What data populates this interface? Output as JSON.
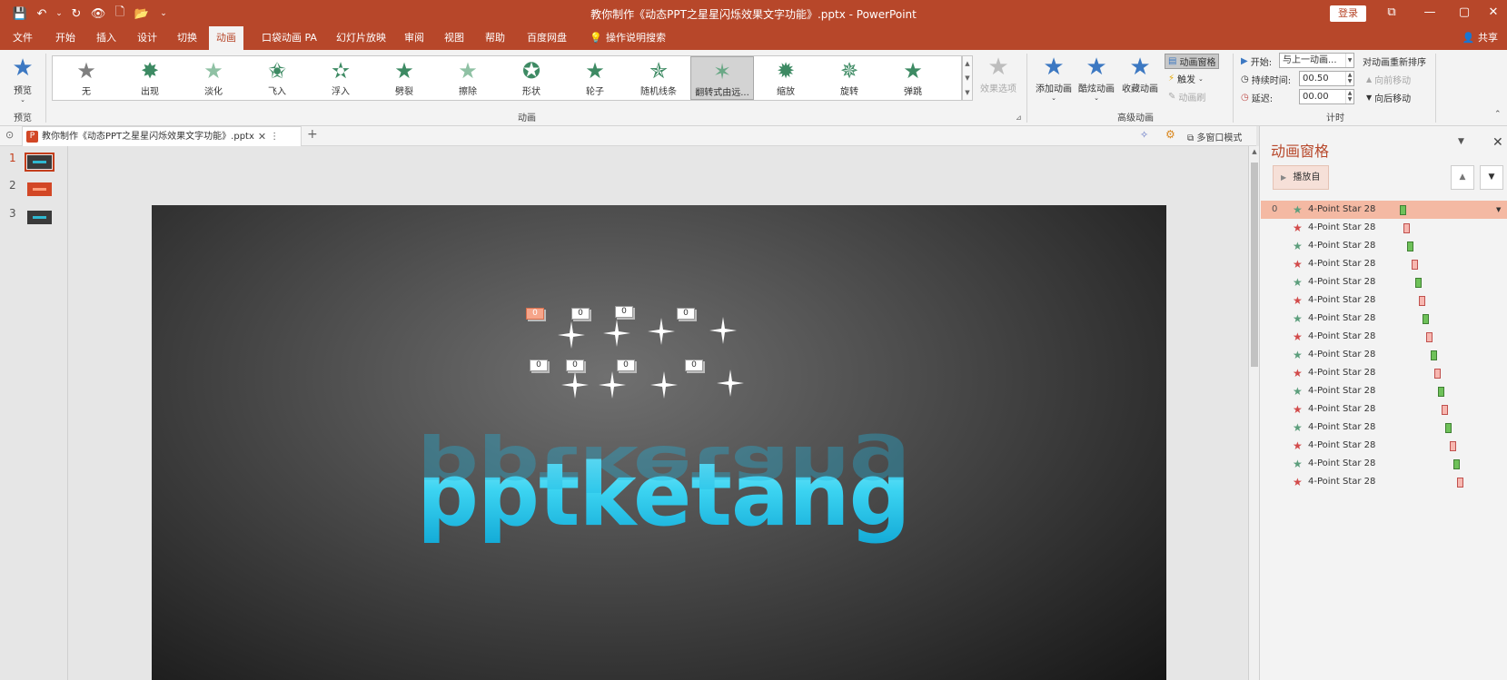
{
  "window": {
    "title": "教你制作《动态PPT之星星闪烁效果文字功能》.pptx - PowerPoint",
    "login_label": "登录",
    "controls": [
      "⧉",
      "—",
      "▢",
      "✕"
    ]
  },
  "quick_access": [
    "💾",
    "↶",
    "⌄",
    "↻",
    "👁",
    "🗋",
    "📂",
    "⌄"
  ],
  "tabs": [
    {
      "label": "文件"
    },
    {
      "label": "开始"
    },
    {
      "label": "插入"
    },
    {
      "label": "设计"
    },
    {
      "label": "切换"
    },
    {
      "label": "动画"
    },
    {
      "label": "口袋动画 PA"
    },
    {
      "label": "幻灯片放映"
    },
    {
      "label": "审阅"
    },
    {
      "label": "视图"
    },
    {
      "label": "帮助"
    },
    {
      "label": "百度网盘"
    },
    {
      "label": "操作说明搜索"
    }
  ],
  "share_label": "共享",
  "ribbon": {
    "preview_label": "预览",
    "group_preview": "预览",
    "group_animation": "动画",
    "group_advanced": "高级动画",
    "group_timing": "计时",
    "effects": [
      {
        "label": "无",
        "color": "#7f7f7f"
      },
      {
        "label": "出现",
        "color": "#3d8a63"
      },
      {
        "label": "淡化",
        "color": "#8fc1a4"
      },
      {
        "label": "飞入",
        "color": "#3d8a63"
      },
      {
        "label": "浮入",
        "color": "#3d8a63"
      },
      {
        "label": "劈裂",
        "color": "#3d8a63"
      },
      {
        "label": "擦除",
        "color": "#8fc1a4"
      },
      {
        "label": "形状",
        "color": "#3d8a63"
      },
      {
        "label": "轮子",
        "color": "#3d8a63"
      },
      {
        "label": "随机线条",
        "color": "#3d8a63"
      },
      {
        "label": "翻转式由远...",
        "color": "#6aa886"
      },
      {
        "label": "缩放",
        "color": "#3d8a63"
      },
      {
        "label": "旋转",
        "color": "#3d8a63"
      },
      {
        "label": "弹跳",
        "color": "#3d8a63"
      }
    ],
    "effect_options_label": "效果选项",
    "add_animation_label": "添加动画",
    "cool_animation_label": "酷炫动画",
    "fav_animation_label": "收藏动画",
    "anim_pane_label": "动画窗格",
    "trigger_label": "触发",
    "anim_painter_label": "动画刷",
    "start_label": "开始:",
    "start_value": "与上一动画...",
    "duration_label": "持续时间:",
    "duration_value": "00.50",
    "delay_label": "延迟:",
    "delay_value": "00.00",
    "reorder_label": "对动画重新排序",
    "move_earlier_label": "向前移动",
    "move_later_label": "向后移动"
  },
  "doc_tab": {
    "title": "教你制作《动态PPT之星星闪烁效果文字功能》.pptx",
    "multi_window_label": "多窗口模式"
  },
  "slides": [
    {
      "num": "1",
      "active": true
    },
    {
      "num": "2",
      "active": false
    },
    {
      "num": "3",
      "active": false
    }
  ],
  "slide": {
    "text": "pptketang",
    "tag_label": "0"
  },
  "pane": {
    "title": "动画窗格",
    "play_label": "播放自",
    "items": [
      {
        "num": "0",
        "name": "4-Point Star 28",
        "kind": "g",
        "offset": 0
      },
      {
        "num": "",
        "name": "4-Point Star 28",
        "kind": "r",
        "offset": 1
      },
      {
        "num": "",
        "name": "4-Point Star 28",
        "kind": "g",
        "offset": 2
      },
      {
        "num": "",
        "name": "4-Point Star 28",
        "kind": "r",
        "offset": 3
      },
      {
        "num": "",
        "name": "4-Point Star 28",
        "kind": "g",
        "offset": 4
      },
      {
        "num": "",
        "name": "4-Point Star 28",
        "kind": "r",
        "offset": 5
      },
      {
        "num": "",
        "name": "4-Point Star 28",
        "kind": "g",
        "offset": 6
      },
      {
        "num": "",
        "name": "4-Point Star 28",
        "kind": "r",
        "offset": 7
      },
      {
        "num": "",
        "name": "4-Point Star 28",
        "kind": "g",
        "offset": 8
      },
      {
        "num": "",
        "name": "4-Point Star 28",
        "kind": "r",
        "offset": 9
      },
      {
        "num": "",
        "name": "4-Point Star 28",
        "kind": "g",
        "offset": 10
      },
      {
        "num": "",
        "name": "4-Point Star 28",
        "kind": "r",
        "offset": 11
      },
      {
        "num": "",
        "name": "4-Point Star 28",
        "kind": "g",
        "offset": 12
      },
      {
        "num": "",
        "name": "4-Point Star 28",
        "kind": "r",
        "offset": 13
      },
      {
        "num": "",
        "name": "4-Point Star 28",
        "kind": "g",
        "offset": 14
      },
      {
        "num": "",
        "name": "4-Point Star 28",
        "kind": "r",
        "offset": 15
      }
    ]
  }
}
